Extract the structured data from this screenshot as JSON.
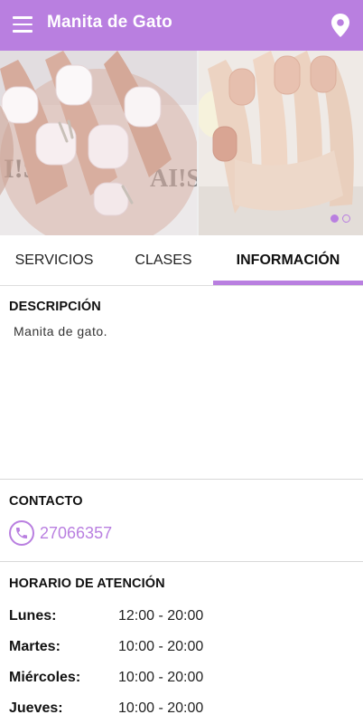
{
  "app": {
    "title": "Manita de Gato",
    "colors": {
      "accent": "#b97fe0",
      "text": "#111111",
      "divider": "#d8d8d8"
    },
    "icons": {
      "menu": "hamburger-menu-icon",
      "location": "location-pin-icon",
      "phone": "phone-icon"
    }
  },
  "carousel": {
    "slides": [
      {
        "alt": "Uñas con francesa en degradado blanco y rosa"
      },
      {
        "alt": "Uñas nude rosadas"
      }
    ],
    "active_index": 0,
    "count": 2
  },
  "tabs": [
    {
      "label": "SERVICIOS",
      "active": false
    },
    {
      "label": "CLASES",
      "active": false
    },
    {
      "label": "INFORMACIÓN",
      "active": true
    }
  ],
  "description": {
    "title": "DESCRIPCIÓN",
    "text": "Manita de gato."
  },
  "contact": {
    "title": "CONTACTO",
    "phone": "27066357"
  },
  "schedule": {
    "title": "HORARIO DE ATENCIÓN",
    "rows": [
      {
        "day": "Lunes:",
        "hours": "12:00 - 20:00"
      },
      {
        "day": "Martes:",
        "hours": "10:00 - 20:00"
      },
      {
        "day": "Miércoles:",
        "hours": "10:00 - 20:00"
      },
      {
        "day": "Jueves:",
        "hours": "10:00 - 20:00"
      }
    ]
  }
}
